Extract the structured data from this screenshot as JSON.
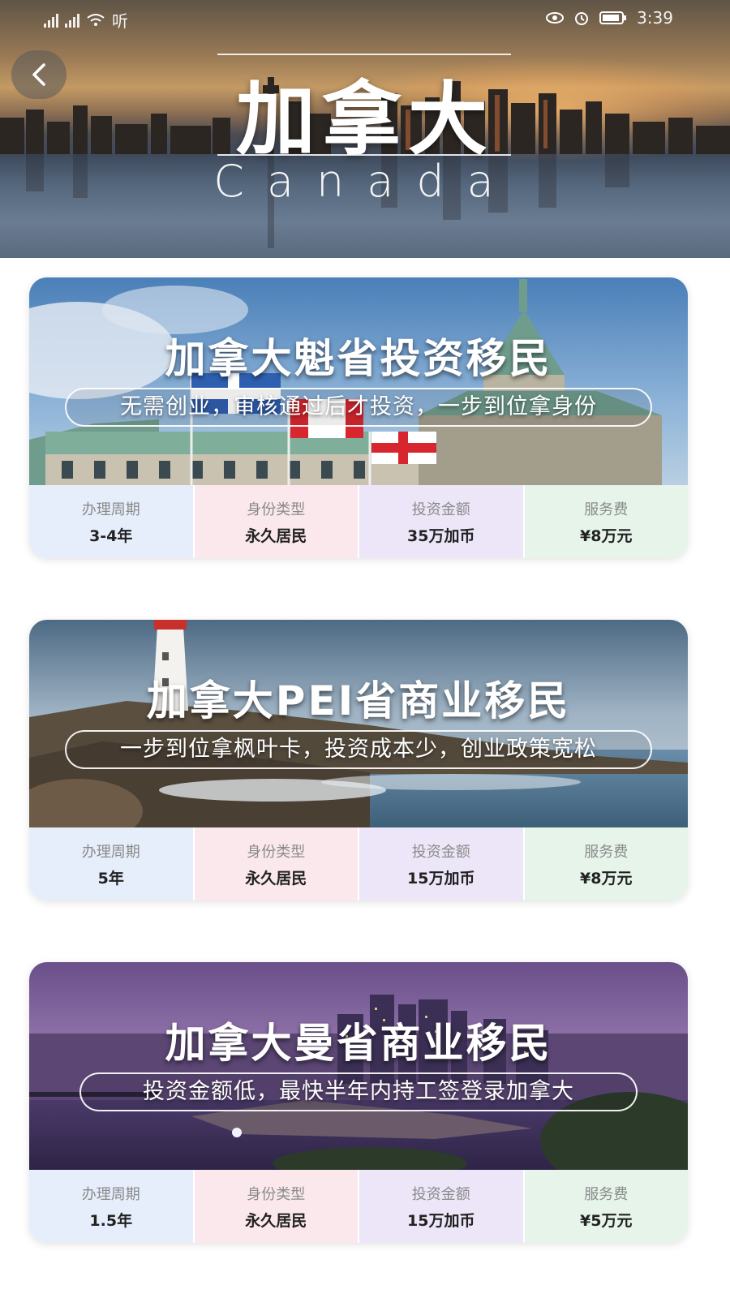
{
  "statusbar": {
    "left_text": "听",
    "time": "3:39"
  },
  "header": {
    "back_icon": "chevron-left-icon",
    "title": "加拿大",
    "subtitle": "Canada"
  },
  "programs": [
    {
      "title": "加拿大魁省投资移民",
      "slogan": "无需创业，审核通过后才投资，一步到位拿身份",
      "stats": [
        {
          "label": "办理周期",
          "value": "3-4年"
        },
        {
          "label": "身份类型",
          "value": "永久居民"
        },
        {
          "label": "投资金额",
          "value": "35万加币"
        },
        {
          "label": "服务费",
          "value": "¥8万元"
        }
      ]
    },
    {
      "title": "加拿大PEI省商业移民",
      "slogan": "一步到位拿枫叶卡，投资成本少，创业政策宽松",
      "stats": [
        {
          "label": "办理周期",
          "value": "5年"
        },
        {
          "label": "身份类型",
          "value": "永久居民"
        },
        {
          "label": "投资金额",
          "value": "15万加币"
        },
        {
          "label": "服务费",
          "value": "¥8万元"
        }
      ]
    },
    {
      "title": "加拿大曼省商业移民",
      "slogan": "投资金额低，最快半年内持工签登录加拿大",
      "stats": [
        {
          "label": "办理周期",
          "value": "1.5年"
        },
        {
          "label": "身份类型",
          "value": "永久居民"
        },
        {
          "label": "投资金额",
          "value": "15万加币"
        },
        {
          "label": "服务费",
          "value": "¥5万元"
        }
      ]
    }
  ],
  "colors": {
    "stat_period_bg": "#e6eefb",
    "stat_type_bg": "#fbe8ec",
    "stat_amount_bg": "#ece6f8",
    "stat_fee_bg": "#e6f4ea"
  }
}
